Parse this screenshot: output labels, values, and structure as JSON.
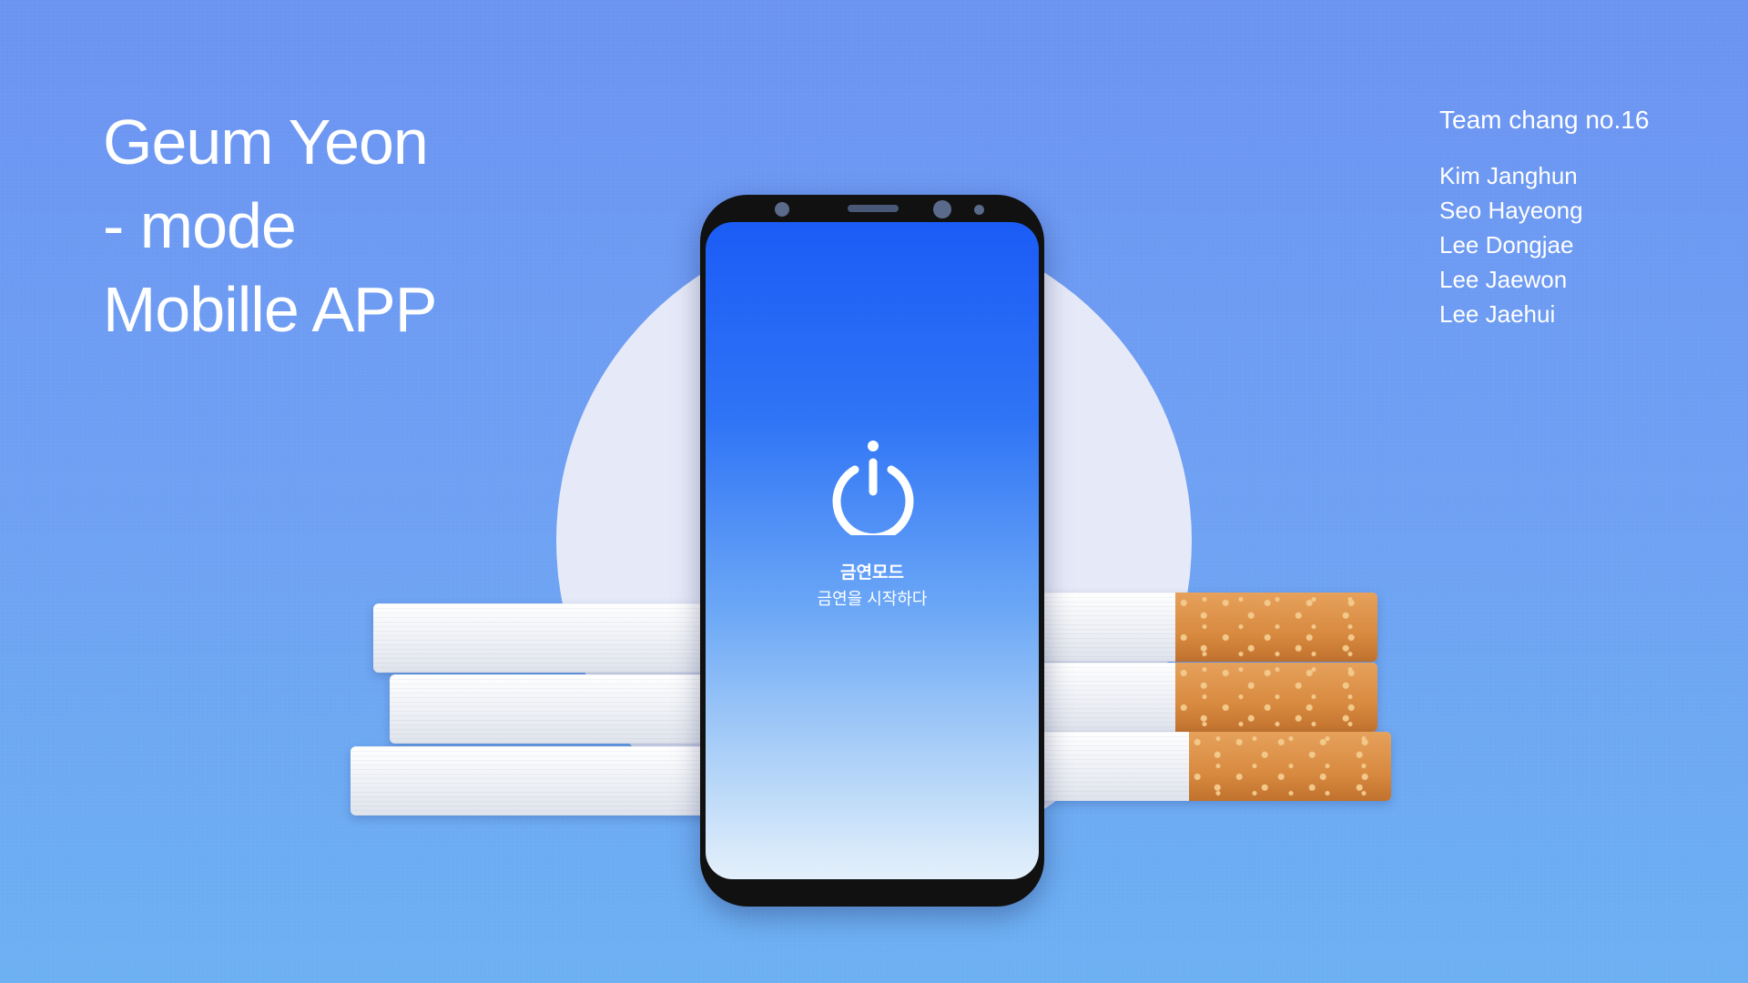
{
  "title": {
    "line1": "Geum Yeon",
    "line2": "- mode",
    "line3": "Mobille APP"
  },
  "team": {
    "title": "Team chang no.16",
    "members": [
      "Kim Janghun",
      "Seo Hayeong",
      "Lee Dongjae",
      "Lee Jaewon",
      "Lee Jaehui"
    ]
  },
  "app_screen": {
    "name": "금연모드",
    "tagline": "금연을 시작하다",
    "icon": "power-icon"
  },
  "colors": {
    "background": "#6b93f2",
    "screen_top": "#1b5cf6",
    "screen_bottom": "#e4f0fb",
    "text": "#ffffff"
  }
}
